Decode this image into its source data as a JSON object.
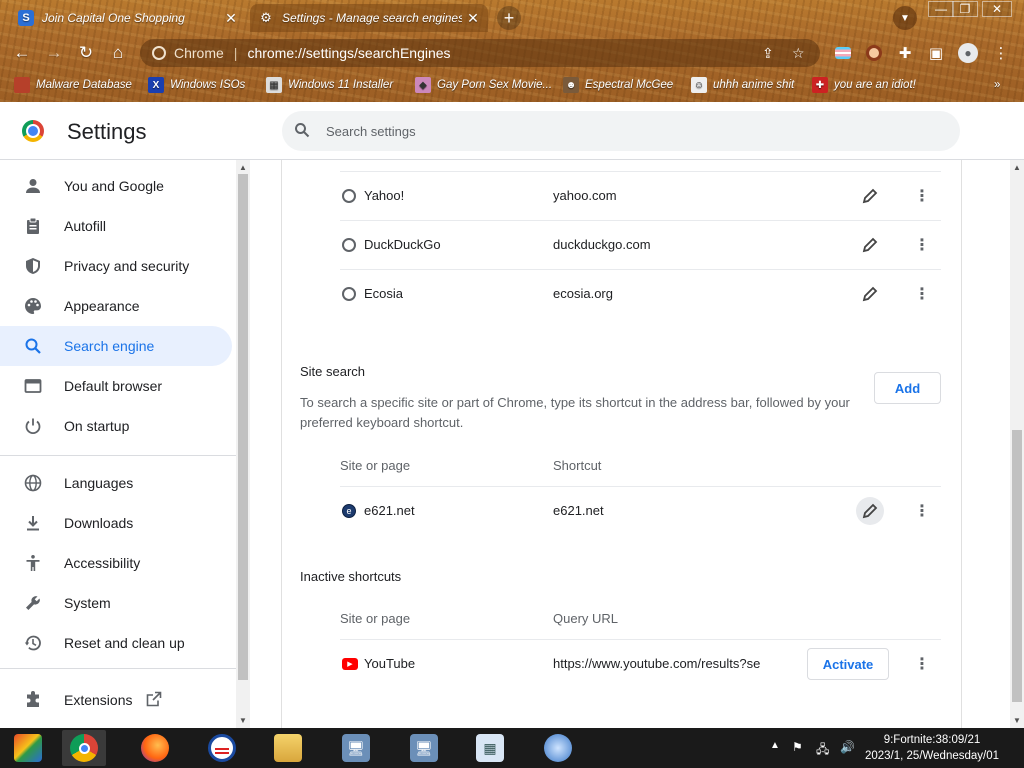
{
  "tabs": [
    {
      "title": "Join Capital One Shopping",
      "favicon": "S"
    },
    {
      "title": "Settings - Manage search engines",
      "favicon": "gear"
    }
  ],
  "omnibox": {
    "site": "Chrome",
    "url": "chrome://settings/searchEngines"
  },
  "bookmarks": [
    {
      "label": "Malware Database"
    },
    {
      "label": "Windows ISOs"
    },
    {
      "label": "Windows 11 Installer"
    },
    {
      "label": "Gay Porn Sex Movie..."
    },
    {
      "label": "Espectral McGee"
    },
    {
      "label": "uhhh anime shit"
    },
    {
      "label": "you are an idiot!"
    }
  ],
  "header": {
    "title": "Settings",
    "search_placeholder": "Search settings"
  },
  "nav": {
    "items": [
      {
        "label": "You and Google",
        "icon": "person-icon"
      },
      {
        "label": "Autofill",
        "icon": "clipboard-icon"
      },
      {
        "label": "Privacy and security",
        "icon": "shield-icon"
      },
      {
        "label": "Appearance",
        "icon": "palette-icon"
      },
      {
        "label": "Search engine",
        "icon": "search-icon",
        "active": true
      },
      {
        "label": "Default browser",
        "icon": "browser-icon"
      },
      {
        "label": "On startup",
        "icon": "power-icon"
      },
      {
        "label": "Languages",
        "icon": "globe-icon"
      },
      {
        "label": "Downloads",
        "icon": "download-icon"
      },
      {
        "label": "Accessibility",
        "icon": "accessibility-icon"
      },
      {
        "label": "System",
        "icon": "wrench-icon"
      },
      {
        "label": "Reset and clean up",
        "icon": "history-icon"
      },
      {
        "label": "Extensions",
        "icon": "puzzle-icon"
      }
    ]
  },
  "search_engines": [
    {
      "name": "Yahoo!",
      "keyword": "yahoo.com"
    },
    {
      "name": "DuckDuckGo",
      "keyword": "duckduckgo.com"
    },
    {
      "name": "Ecosia",
      "keyword": "ecosia.org"
    }
  ],
  "site_search": {
    "title": "Site search",
    "add_label": "Add",
    "description": "To search a specific site or part of Chrome, type its shortcut in the address bar, followed by your preferred keyboard shortcut.",
    "col_site": "Site or page",
    "col_shortcut": "Shortcut",
    "rows": [
      {
        "name": "e621.net",
        "shortcut": "e621.net"
      }
    ]
  },
  "inactive": {
    "title": "Inactive shortcuts",
    "col_site": "Site or page",
    "col_query": "Query URL",
    "rows": [
      {
        "name": "YouTube",
        "query": "https://www.youtube.com/results?se",
        "action": "Activate"
      }
    ]
  },
  "clock": {
    "time": "9:Fortnite:38:09/21",
    "date": "2023/1, 25/Wednesday/01"
  },
  "colors": {
    "accent": "#1a73e8",
    "active_nav_bg": "#e8f0fe",
    "youtube_red": "#ff0000"
  }
}
